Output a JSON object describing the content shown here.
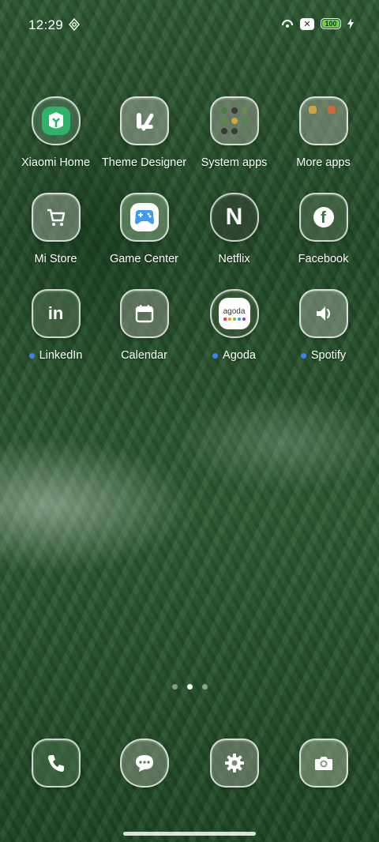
{
  "status_bar": {
    "time": "12:29",
    "battery_level": "100",
    "x_badge": "✕",
    "icons": [
      "settings-gear-icon",
      "hotspot-icon",
      "x-badge-icon",
      "battery-icon",
      "charging-bolt-icon"
    ]
  },
  "apps": [
    {
      "label": "Xiaomi Home",
      "icon": "xiaomi-home-icon",
      "notify": false
    },
    {
      "label": "Theme Designer",
      "icon": "theme-designer-icon",
      "notify": false
    },
    {
      "label": "System apps",
      "icon": "folder-icon",
      "notify": false
    },
    {
      "label": "More apps",
      "icon": "folder-icon",
      "notify": false
    },
    {
      "label": "Mi Store",
      "icon": "cart-icon",
      "notify": false
    },
    {
      "label": "Game Center",
      "icon": "gamepad-icon",
      "notify": false
    },
    {
      "label": "Netflix",
      "icon": "netflix-icon",
      "notify": false
    },
    {
      "label": "Facebook",
      "icon": "facebook-icon",
      "notify": false
    },
    {
      "label": "LinkedIn",
      "icon": "linkedin-icon",
      "notify": true
    },
    {
      "label": "Calendar",
      "icon": "calendar-icon",
      "notify": false
    },
    {
      "label": "Agoda",
      "icon": "agoda-icon",
      "notify": true
    },
    {
      "label": "Spotify",
      "icon": "speaker-icon",
      "notify": true
    }
  ],
  "agoda_logo_text": "agoda",
  "netflix_letter": "N",
  "facebook_letter": "f",
  "linkedin_letters": "in",
  "pages": {
    "count": 3,
    "active_index": 1
  },
  "dock": [
    {
      "name": "phone",
      "icon": "phone-icon"
    },
    {
      "name": "messages",
      "icon": "chat-bubble-icon"
    },
    {
      "name": "settings",
      "icon": "gear-icon"
    },
    {
      "name": "camera",
      "icon": "camera-icon"
    }
  ],
  "colors": {
    "notification_dot": "#3b82f6",
    "battery_fill": "#6bd04b",
    "xiaomi_home_green": "#2fb36a",
    "game_center_blue": "#3d9bf0"
  }
}
